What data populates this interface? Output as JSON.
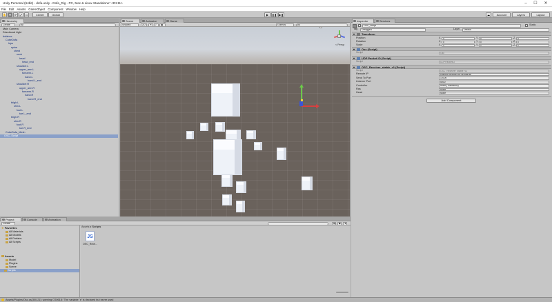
{
  "window": {
    "title": "Unity Personal (64bit) - dofa.unity - Dofa_Rig - PC, Mac & Linux Standalone* <DX11>",
    "minimize": "–",
    "maximize": "☐",
    "close": "✕"
  },
  "menu": [
    "File",
    "Edit",
    "Assets",
    "GameObject",
    "Component",
    "Window",
    "Help"
  ],
  "toolbar": {
    "pivot": "Center",
    "space": "Global",
    "play": "▶",
    "pause": "❚❚",
    "step": "▶❚",
    "collab": "☁",
    "account": "Account",
    "layers": "Layers",
    "layout": "Layout"
  },
  "hierarchy": {
    "tab": "Hierarchy",
    "create": "Create",
    "search_placeholder": "All",
    "items": [
      {
        "label": "Main Camera",
        "color": "plain"
      },
      {
        "label": "Directional Light",
        "color": "plain"
      },
      {
        "label": "dofabox",
        "color": "blue"
      },
      {
        "label": "CubeDofa",
        "color": "blue"
      },
      {
        "label": "hips",
        "color": "blue"
      },
      {
        "label": "spine",
        "color": "blue"
      },
      {
        "label": "chest",
        "color": "blue"
      },
      {
        "label": "neck",
        "color": "blue"
      },
      {
        "label": "head",
        "color": "blue"
      },
      {
        "label": "head_end",
        "color": "blue"
      },
      {
        "label": "shoulder.L",
        "color": "blue"
      },
      {
        "label": "upper_arm.L",
        "color": "blue"
      },
      {
        "label": "forearm.L",
        "color": "blue"
      },
      {
        "label": "hand.L",
        "color": "blue"
      },
      {
        "label": "hand.L_end",
        "color": "blue"
      },
      {
        "label": "shoulder.R",
        "color": "blue"
      },
      {
        "label": "upper_arm.R",
        "color": "blue"
      },
      {
        "label": "forearm.R",
        "color": "blue"
      },
      {
        "label": "hand.R",
        "color": "blue"
      },
      {
        "label": "hand.R_end",
        "color": "blue"
      },
      {
        "label": "thigh.L",
        "color": "blue"
      },
      {
        "label": "shin.L",
        "color": "blue"
      },
      {
        "label": "foot.L",
        "color": "blue"
      },
      {
        "label": "toe.L_end",
        "color": "blue"
      },
      {
        "label": "thigh.R",
        "color": "blue"
      },
      {
        "label": "shin.R",
        "color": "blue"
      },
      {
        "label": "foot.R",
        "color": "blue"
      },
      {
        "label": "toe.R_end",
        "color": "blue"
      },
      {
        "label": "CubeDofa_Mesh",
        "color": "blue"
      },
      {
        "label": "OSC_Script",
        "color": "selected"
      }
    ]
  },
  "scene": {
    "tabs": [
      "Scene",
      "Animator",
      "Game"
    ],
    "shading": "Shaded",
    "mode": "2D",
    "gizmos": "Gizmos",
    "search": "All",
    "persp": "< Persp"
  },
  "inspector": {
    "tabs": [
      "Inspector",
      "Services"
    ],
    "object_name": "OSC_Script",
    "static": "Static",
    "tag_label": "Tag",
    "tag_value": "Untagged",
    "layer_label": "Layer",
    "layer_value": "Default",
    "transform": {
      "title": "Transform",
      "rows": [
        {
          "label": "Position",
          "x": "0",
          "y": "0",
          "z": "0"
        },
        {
          "label": "Rotation",
          "x": "0",
          "y": "0",
          "z": "0"
        },
        {
          "label": "Scale",
          "x": "1",
          "y": "1",
          "z": "1"
        }
      ]
    },
    "osc": {
      "title": "Osc (Script)",
      "script_label": "Script",
      "script_value": "Osc"
    },
    "udp": {
      "title": "UDP Packet IO (Script)",
      "script_label": "Script",
      "script_value": "UDPPacketIO"
    },
    "receiver": {
      "title": "OSC_Receiver_stable_v1 (Script)",
      "rows": [
        {
          "label": "Script",
          "value": "OSC_Receiver_stable_v1"
        },
        {
          "label": "Remote IP",
          "value": "cyanea.mindlab.cor.vernas.de"
        },
        {
          "label": "Send To Port",
          "value": "10000"
        },
        {
          "label": "Listener Port",
          "value": "5000"
        },
        {
          "label": "Controller",
          "value": "None (Transform)"
        },
        {
          "label": "Ras",
          "value": "None"
        },
        {
          "label": "Head",
          "value": "None"
        }
      ]
    },
    "add_component": "Add Component"
  },
  "project": {
    "tabs": [
      "Project",
      "Console",
      "Animation"
    ],
    "create": "Create",
    "favorites": {
      "title": "Favorites",
      "items": [
        "All Materials",
        "All Models",
        "All Prefabs",
        "All Scripts"
      ]
    },
    "assets": {
      "title": "Assets",
      "items": [
        "Model",
        "Plugins",
        "Scene",
        "Scripts"
      ],
      "selected": "Scripts"
    },
    "breadcrumb": [
      "Assets",
      "Scripts"
    ],
    "file": {
      "label": "OSC_Rece...",
      "icon": "JS"
    }
  },
  "status": {
    "text": "Assets/Plugins/Osc.cs(300,21): warning CS0618: 'The variable `e' is declared but never used"
  },
  "colors": {
    "selection": "#8aa0c9",
    "hierarchy_text": "#0f2a7a",
    "ground": "#6a625c",
    "sky": "#c8ced6"
  }
}
